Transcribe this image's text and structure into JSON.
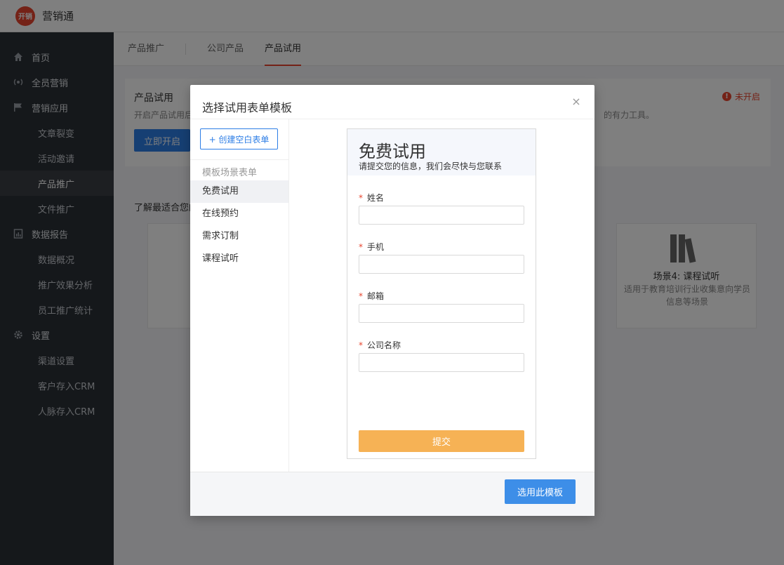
{
  "app": {
    "logo_text": "开销",
    "title": "营销通"
  },
  "sidebar": {
    "items": [
      {
        "label": "首页",
        "type": "group",
        "icon": "home-icon"
      },
      {
        "label": "全员营销",
        "type": "group",
        "icon": "broadcast-icon"
      },
      {
        "label": "营销应用",
        "type": "group",
        "icon": "flag-icon"
      },
      {
        "label": "文章裂变",
        "type": "sub"
      },
      {
        "label": "活动邀请",
        "type": "sub"
      },
      {
        "label": "产品推广",
        "type": "sub",
        "active": true
      },
      {
        "label": "文件推广",
        "type": "sub"
      },
      {
        "label": "数据报告",
        "type": "group",
        "icon": "report-icon"
      },
      {
        "label": "数据概况",
        "type": "sub"
      },
      {
        "label": "推广效果分析",
        "type": "sub"
      },
      {
        "label": "员工推广统计",
        "type": "sub"
      },
      {
        "label": "设置",
        "type": "group",
        "icon": "gear-icon"
      },
      {
        "label": "渠道设置",
        "type": "sub"
      },
      {
        "label": "客户存入CRM",
        "type": "sub"
      },
      {
        "label": "人脉存入CRM",
        "type": "sub"
      }
    ]
  },
  "tabs": [
    {
      "label": "产品推广"
    },
    {
      "label": "公司产品"
    },
    {
      "label": "产品试用",
      "active": true
    }
  ],
  "card": {
    "title": "产品试用",
    "desc": "开启产品试用后",
    "desc_right": "的有力工具。",
    "status": "未开启",
    "button": "立即开启"
  },
  "section_title": "了解最适合您的",
  "scenes": [
    {
      "title": "场景4: 课程试听",
      "desc": "适用于教育培训行业收集意向学员信息等场景"
    }
  ],
  "modal": {
    "title": "选择试用表单模板",
    "close": "×",
    "create_button": "+ 创建空白表单",
    "heading": "模板场景表单",
    "templates": [
      {
        "label": "免费试用",
        "active": true
      },
      {
        "label": "在线预约"
      },
      {
        "label": "需求订制"
      },
      {
        "label": "课程试听"
      }
    ],
    "confirm_button": "选用此模板"
  },
  "preview": {
    "title": "免费试用",
    "subtitle": "请提交您的信息，我们会尽快与您联系",
    "fields": [
      {
        "label": "姓名"
      },
      {
        "label": "手机"
      },
      {
        "label": "邮箱"
      },
      {
        "label": "公司名称"
      }
    ],
    "required_mark": "*",
    "submit": "提交"
  },
  "colors": {
    "accent": "#e8452e",
    "primary": "#3d8ee8",
    "submit": "#f6b255",
    "sidebar_bg": "#2b3036"
  }
}
